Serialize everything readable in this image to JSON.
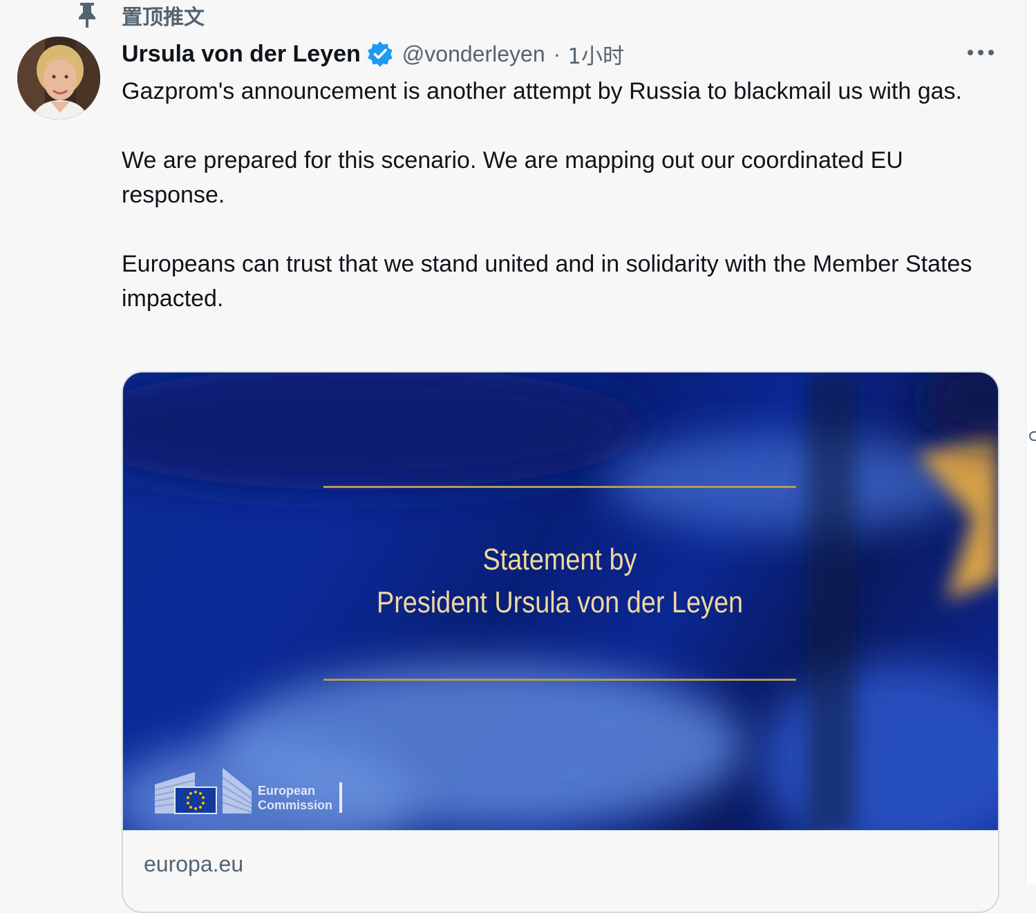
{
  "pinned": {
    "label": "置顶推文",
    "icon": "pin-icon"
  },
  "tweet": {
    "author": {
      "display_name": "Ursula von der Leyen",
      "handle": "@vonderleyen",
      "verified": true,
      "avatar_icon": "avatar"
    },
    "separator": "·",
    "time": "1小时",
    "paragraphs": [
      "Gazprom's announcement is another attempt by Russia to blackmail us with gas.",
      "We are prepared for this scenario. We are mapping out our coordinated EU response.",
      "Europeans can trust that we stand united and in solidarity with the Member States impacted."
    ],
    "card": {
      "image_title_line1": "Statement by",
      "image_title_line2": "President Ursula von der Leyen",
      "logo_text_line1": "European",
      "logo_text_line2": "Commission",
      "domain": "europa.eu"
    }
  },
  "colors": {
    "verified": "#1d9bf0",
    "secondary_text": "#536471",
    "gold": "#f1d89c",
    "card_blue": "#0c2a9a"
  }
}
